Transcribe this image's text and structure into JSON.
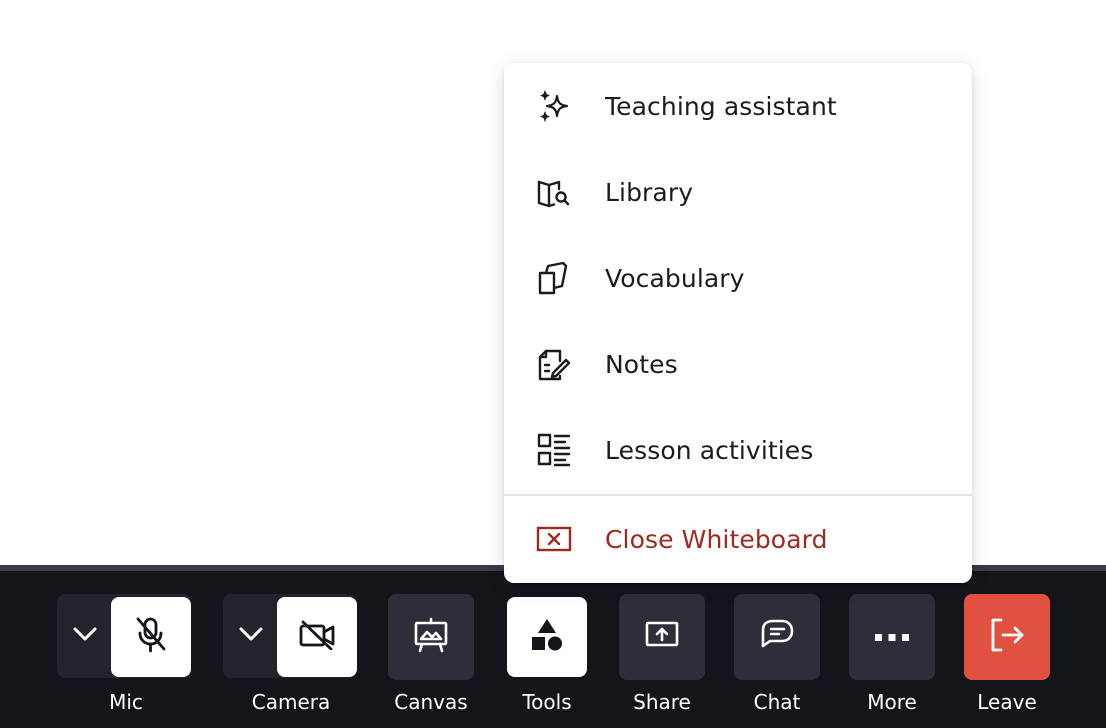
{
  "menu": {
    "items": [
      {
        "label": "Teaching assistant",
        "icon": "sparkles-icon"
      },
      {
        "label": "Library",
        "icon": "book-search-icon"
      },
      {
        "label": "Vocabulary",
        "icon": "cards-icon"
      },
      {
        "label": "Notes",
        "icon": "note-edit-icon"
      },
      {
        "label": "Lesson activities",
        "icon": "activities-list-icon"
      }
    ],
    "close": {
      "label": "Close Whiteboard",
      "icon": "close-box-icon",
      "color": "#9d2a1f"
    }
  },
  "toolbar": {
    "mic": {
      "label": "Mic",
      "icon": "mic-off-icon"
    },
    "camera": {
      "label": "Camera",
      "icon": "camera-off-icon"
    },
    "canvas": {
      "label": "Canvas",
      "icon": "easel-icon"
    },
    "tools": {
      "label": "Tools",
      "icon": "shapes-icon"
    },
    "share": {
      "label": "Share",
      "icon": "screen-share-icon"
    },
    "chat": {
      "label": "Chat",
      "icon": "chat-icon"
    },
    "more": {
      "label": "More",
      "icon": "ellipsis-icon"
    },
    "leave": {
      "label": "Leave",
      "icon": "exit-icon",
      "color": "#e0513f"
    }
  }
}
